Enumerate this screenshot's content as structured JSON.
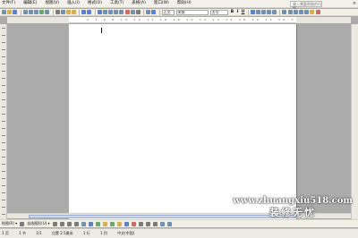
{
  "menubar": {
    "items": [
      "文件(F)",
      "编辑(E)",
      "视图(V)",
      "插入(I)",
      "格式(O)",
      "工具(T)",
      "表格(A)",
      "窗口(W)",
      "帮助(H)"
    ],
    "help_placeholder": "键入需要帮助的问题",
    "close_glyph": "×"
  },
  "toolbar": {
    "style_value": "正文",
    "font_value": "宋体",
    "size_value": "五号",
    "bold_label": "B",
    "italic_label": "I",
    "underline_label": "U"
  },
  "ruler": {
    "scale": "2 4 6 8 10 12 14 16 18 20 22 24 26 28 30 32 34 36 38"
  },
  "drawbar": {
    "draw_label": "绘图(R) ▾",
    "autoshape_label": "自选图形(U) ▾"
  },
  "statusbar": {
    "page": "1 页",
    "section": "1 节",
    "pages": "1/1",
    "position": "位置 2.5厘米",
    "line": "1 行",
    "column": "1 列",
    "language": "中文(中国)"
  },
  "watermark": {
    "url": "www.zhuangxiu518.com",
    "brand": "装修无忧"
  }
}
